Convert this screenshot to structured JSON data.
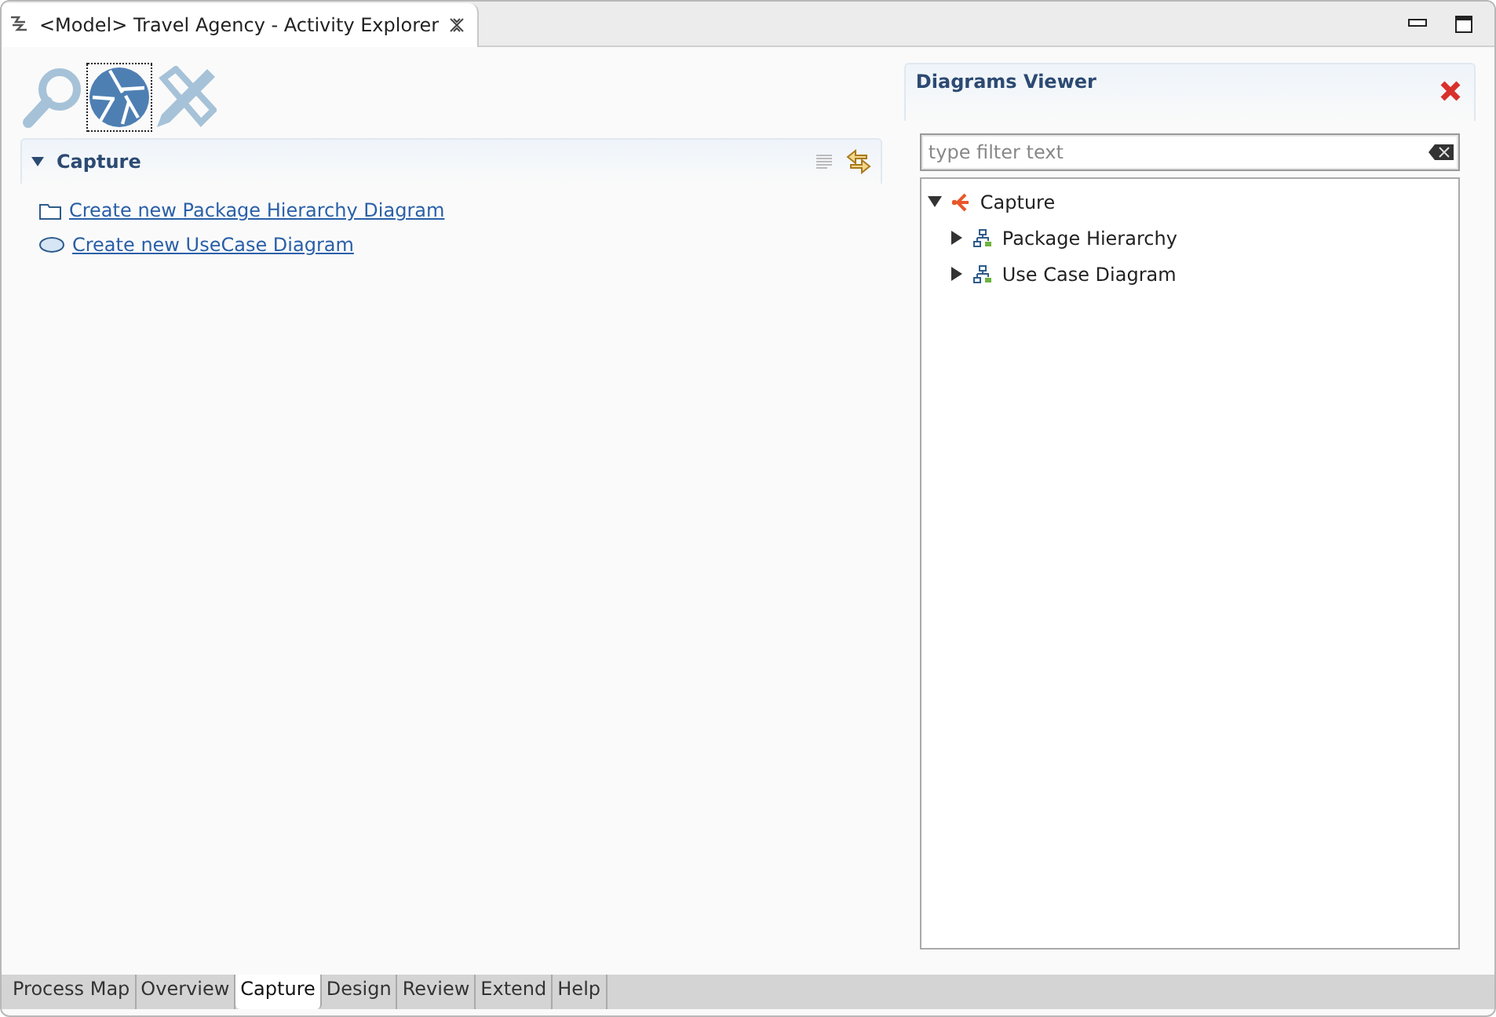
{
  "editor_tab": {
    "title": "<Model> Travel Agency - Activity Explorer"
  },
  "activity_icons": [
    {
      "kind": "search",
      "selected": false
    },
    {
      "kind": "shutter",
      "selected": true
    },
    {
      "kind": "pencil",
      "selected": false
    }
  ],
  "section": {
    "title": "Capture",
    "expanded": true,
    "links": [
      {
        "kind": "package",
        "label": "Create new Package Hierarchy Diagram"
      },
      {
        "kind": "usecase",
        "label": "Create new UseCase Diagram"
      }
    ]
  },
  "diagrams_viewer": {
    "title": "Diagrams Viewer",
    "filter": {
      "placeholder": "type filter text"
    },
    "tree": [
      {
        "kind": "capture",
        "label": "Capture",
        "expanded": true,
        "children": [
          {
            "kind": "diagram",
            "label": "Package Hierarchy",
            "expanded": false
          },
          {
            "kind": "diagram",
            "label": "Use Case Diagram",
            "expanded": false
          }
        ]
      }
    ]
  },
  "bottom_tabs": [
    {
      "label": "Process Map",
      "selected": false
    },
    {
      "label": "Overview",
      "selected": false
    },
    {
      "label": "Capture",
      "selected": true
    },
    {
      "label": "Design",
      "selected": false
    },
    {
      "label": "Review",
      "selected": false
    },
    {
      "label": "Extend",
      "selected": false
    },
    {
      "label": "Help",
      "selected": false
    }
  ]
}
